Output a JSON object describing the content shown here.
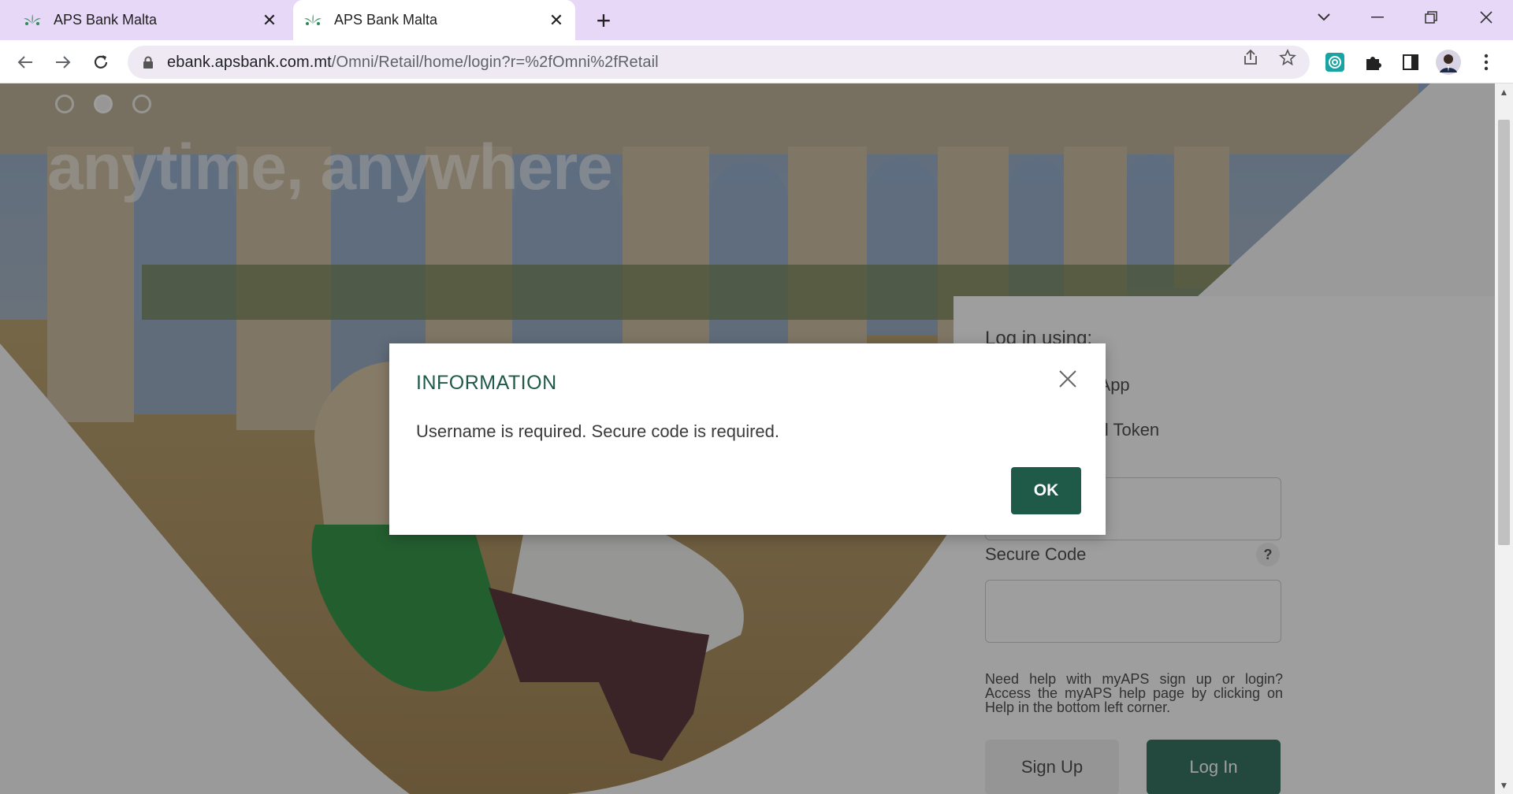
{
  "browser": {
    "tabs": [
      {
        "title": "APS Bank Malta",
        "active": false
      },
      {
        "title": "APS Bank Malta",
        "active": true
      }
    ],
    "new_tab_icon": "plus-icon",
    "url_host": "ebank.apsbank.com.mt",
    "url_path": "/Omni/Retail/home/login?r=%2fOmni%2fRetail"
  },
  "hero": {
    "headline": "anytime, anywhere",
    "slide_count": 3,
    "active_slide": 2
  },
  "login": {
    "title": "Log in using:",
    "option_mobile": "and Mobile App",
    "option_token": "and Physical Token",
    "secure_code_label": "Secure Code",
    "help_icon": "?",
    "help_text": "Need help with myAPS sign up or login? Access the myAPS help page by clicking on Help in the bottom left corner.",
    "sign_up": "Sign Up",
    "log_in": "Log In"
  },
  "modal": {
    "title": "INFORMATION",
    "message": "Username is required. Secure code is required.",
    "ok": "OK"
  },
  "colors": {
    "brand_green": "#1f5a49",
    "tab_bar": "#e8d8f8"
  }
}
